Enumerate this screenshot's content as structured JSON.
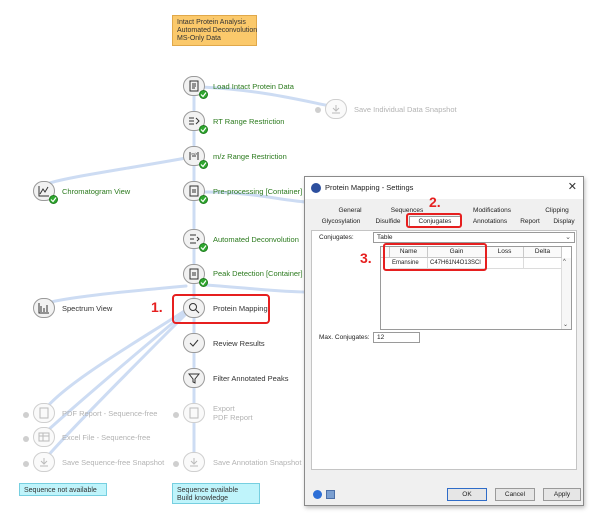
{
  "workflow": {
    "header_note": [
      "Intact Protein Analysis",
      "Automated Deconvolution",
      "MS-Only Data"
    ],
    "nodes": {
      "load": "Load Intact Protein Data",
      "save_individual": "Save Individual Data Snapshot",
      "rt": "RT Range Restriction",
      "mz": "m/z Range Restriction",
      "chromatogram": "Chromatogram View",
      "preprocessing": "Pre-processing [Container]",
      "deconvolution": "Automated Deconvolution",
      "peak_detection": "Peak Detection [Container]",
      "spectrum": "Spectrum View",
      "protein_mapping": "Protein Mapping",
      "review": "Review Results",
      "filter": "Filter Annotated Peaks",
      "pdf_report": "PDF Report - Sequence-free",
      "export_line1": "Export",
      "export_line2": "PDF Report",
      "excel": "Excel File - Sequence-free",
      "save_seqfree": "Save Sequence-free Snapshot",
      "save_annotation": "Save Annotation Snapshot"
    },
    "notes": {
      "seq_not_available": "Sequence not available",
      "seq_available": [
        "Sequence available",
        "Build knowledge"
      ]
    },
    "step_labels": {
      "step1": "1.",
      "step2": "2.",
      "step3": "3."
    }
  },
  "dialog": {
    "title": "Protein Mapping - Settings",
    "close": "✕",
    "tabs_row1": [
      "General",
      "Sequences",
      "Modifications",
      "Clipping"
    ],
    "tabs_row2": [
      "Glycosylation",
      "Disulfide",
      "Conjugates",
      "Annotations",
      "Report",
      "Display"
    ],
    "conjugates_label": "Conjugates:",
    "conjugates_value": "Table",
    "table": {
      "columns": [
        "Name",
        "Gain",
        "Loss",
        "Delta"
      ],
      "rows": [
        {
          "marker": "-",
          "name": "Emansine",
          "gain": "C47H61N4O13SCl",
          "loss": "",
          "delta": ""
        }
      ]
    },
    "max_label": "Max. Conjugates:",
    "max_value": "12",
    "buttons": {
      "ok": "OK",
      "cancel": "Cancel",
      "apply": "Apply"
    }
  },
  "colors": {
    "accent_red": "#e61f1f",
    "node_label_green": "#2b7a1d",
    "connector": "#c7d8f2"
  }
}
